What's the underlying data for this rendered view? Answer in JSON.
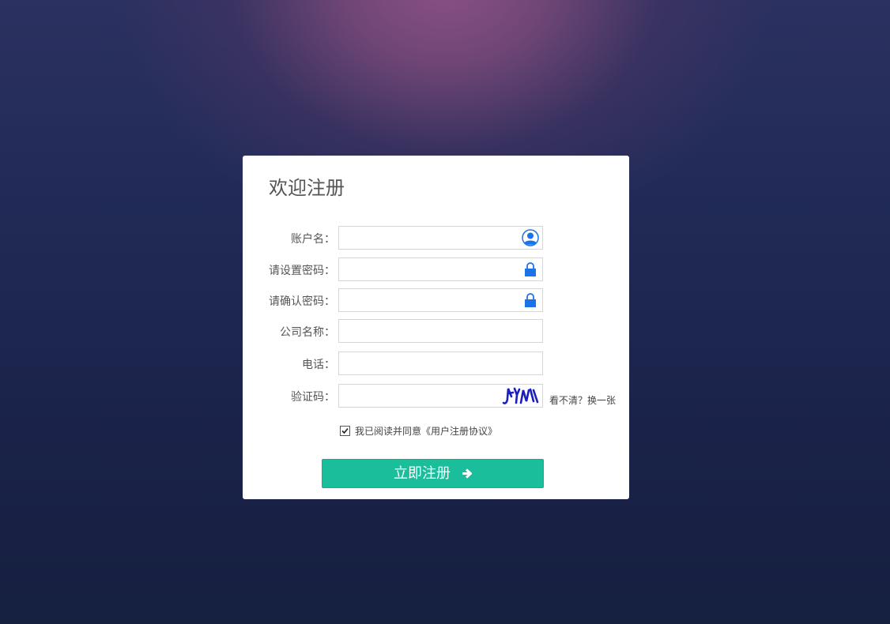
{
  "form": {
    "title": "欢迎注册",
    "fields": [
      {
        "label": "账户名：",
        "value": "",
        "placeholder": "",
        "icon": "user-icon"
      },
      {
        "label": "请设置密码：",
        "value": "",
        "placeholder": "",
        "icon": "lock-icon"
      },
      {
        "label": "请确认密码：",
        "value": "",
        "placeholder": "",
        "icon": "lock-icon"
      },
      {
        "label": "公司名称：",
        "value": "",
        "placeholder": ""
      },
      {
        "label": "电话：",
        "value": "",
        "placeholder": ""
      },
      {
        "label": "验证码：",
        "value": "",
        "placeholder": ""
      }
    ],
    "captcha": {
      "refresh_text": "看不清？换一张"
    },
    "agreement": {
      "checked": true,
      "text": "我已阅读并同意《用户注册协议》"
    },
    "submit_label": "立即注册"
  },
  "colors": {
    "accent": "#1bbe9b",
    "icon_blue": "#1a74e8"
  }
}
